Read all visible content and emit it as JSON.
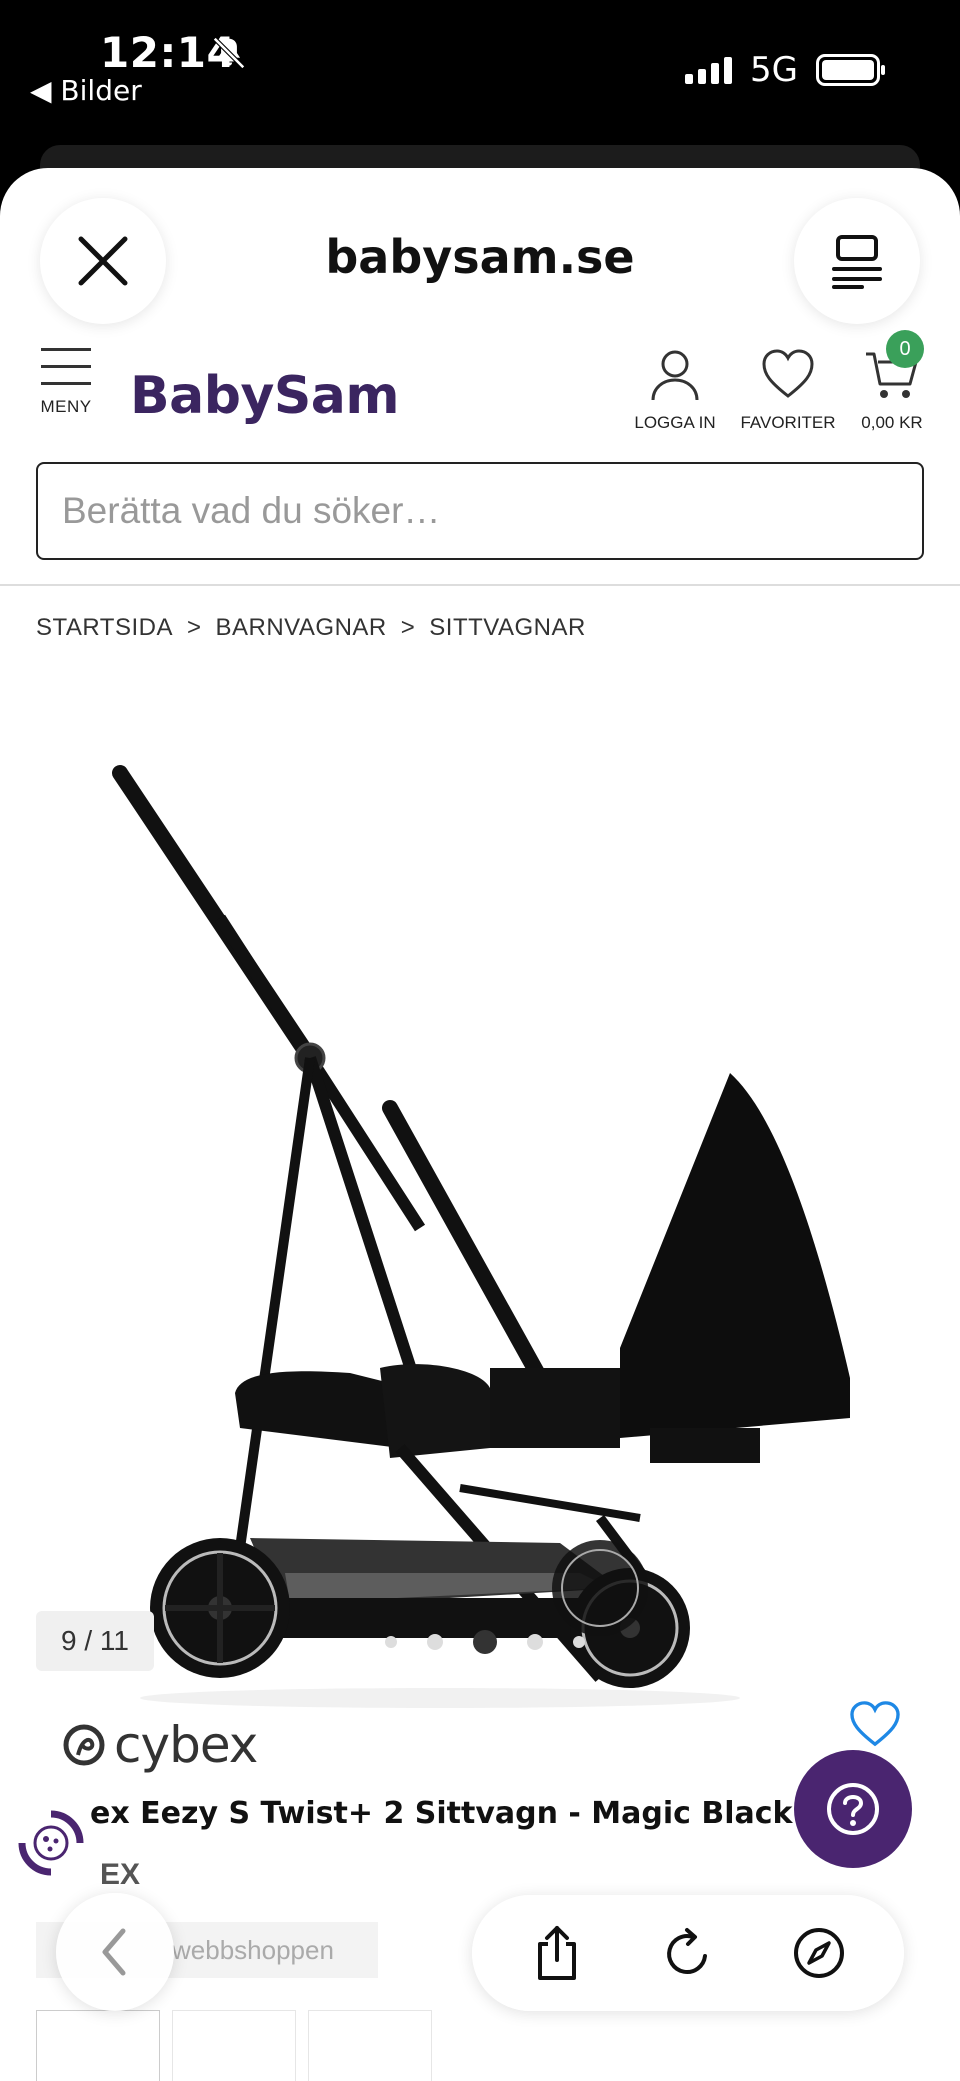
{
  "status_bar": {
    "time": "12:14",
    "back_label": "◀ Bilder",
    "network": "5G"
  },
  "browser": {
    "domain": "babysam.se"
  },
  "header": {
    "logo": "BabySam",
    "menu_label": "MENY",
    "login_label": "LOGGA IN",
    "favorites_label": "FAVORITER",
    "cart_label": "0,00 KR",
    "cart_count": "0"
  },
  "search": {
    "placeholder": "Berätta vad du söker…"
  },
  "breadcrumb": [
    "STARTSIDA",
    ">",
    "BARNVAGNAR",
    ">",
    "SITTVAGNAR"
  ],
  "gallery": {
    "counter": "9 / 11",
    "active_dot": 2
  },
  "product": {
    "brand_logo": "cybex",
    "title": "ex Eezy S Twist+ 2 Sittvagn - Magic Black",
    "brand_sub": "EX",
    "webshop_label": "webbshoppen"
  },
  "colors": {
    "brand_purple": "#3b2560",
    "help_purple": "#4a2570",
    "cart_badge_green": "#3aa05a",
    "heart_blue": "#1e88e5"
  }
}
